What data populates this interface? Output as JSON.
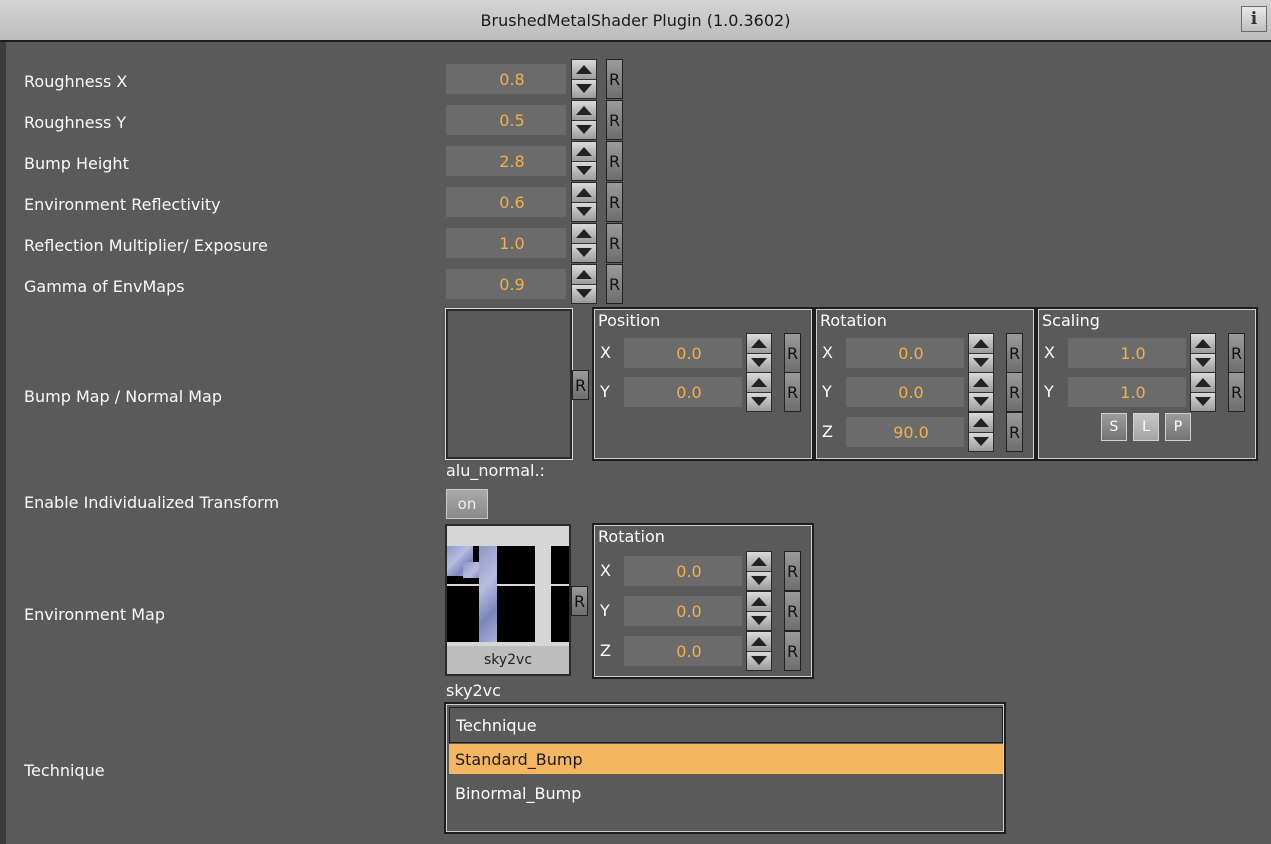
{
  "title": "BrushedMetalShader Plugin (1.0.3602)",
  "info_icon": "i",
  "params": [
    {
      "label": "Roughness X",
      "value": "0.8"
    },
    {
      "label": "Roughness Y",
      "value": "0.5"
    },
    {
      "label": "Bump Height",
      "value": "2.8"
    },
    {
      "label": "Environment Reflectivity",
      "value": "0.6"
    },
    {
      "label": "Reflection Multiplier/ Exposure",
      "value": "1.0"
    },
    {
      "label": "Gamma of EnvMaps",
      "value": "0.9"
    }
  ],
  "reset_label": "R",
  "bump_map": {
    "label": "Bump Map / Normal Map",
    "filename": "alu_normal.:",
    "position": {
      "title": "Position",
      "x": "0.0",
      "y": "0.0"
    },
    "rotation": {
      "title": "Rotation",
      "x": "0.0",
      "y": "0.0",
      "z": "90.0"
    },
    "scaling": {
      "title": "Scaling",
      "x": "1.0",
      "y": "1.0"
    },
    "scale_buttons": {
      "s": "S",
      "l": "L",
      "p": "P"
    }
  },
  "axes": {
    "x": "X",
    "y": "Y",
    "z": "Z"
  },
  "individualized_transform": {
    "label": "Enable Individualized Transform",
    "state": "on"
  },
  "environment_map": {
    "label": "Environment Map",
    "thumb_caption": "sky2vc",
    "filename": "sky2vc",
    "rotation": {
      "title": "Rotation",
      "x": "0.0",
      "y": "0.0",
      "z": "0.0"
    }
  },
  "technique": {
    "label": "Technique",
    "header": "Technique",
    "options": [
      "Standard_Bump",
      "Binormal_Bump"
    ],
    "selected": "Standard_Bump"
  },
  "colors": {
    "value_text": "#f2b24a",
    "selected_row": "#f5b660",
    "background": "#5a5a5a"
  }
}
